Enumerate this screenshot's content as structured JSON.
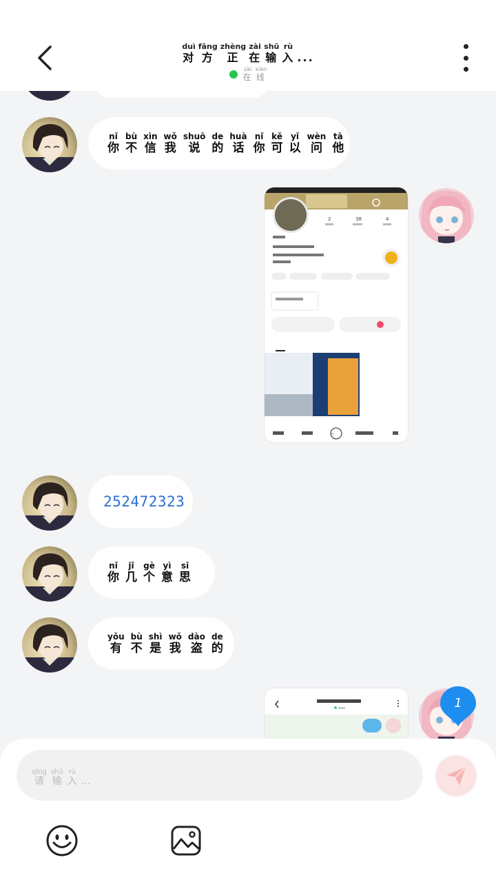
{
  "header": {
    "title_ruby": [
      {
        "py": "duì",
        "hz": "对"
      },
      {
        "py": "fāng",
        "hz": "方"
      },
      {
        "py": "zhèng",
        "hz": "正"
      },
      {
        "py": "zài",
        "hz": "在"
      },
      {
        "py": "shū",
        "hz": "输"
      },
      {
        "py": "rù",
        "hz": "入"
      },
      {
        "py": "",
        "hz": "..."
      }
    ],
    "status_ruby": [
      {
        "py": "zài",
        "hz": "在"
      },
      {
        "py": "xiàn",
        "hz": "线"
      }
    ],
    "status_color": "#26c64a"
  },
  "messages": [
    {
      "id": "m1",
      "from": "other",
      "type": "text",
      "ruby": [
        {
          "py": "nǐ",
          "hz": "你"
        },
        {
          "py": "bù",
          "hz": "不"
        },
        {
          "py": "xìn",
          "hz": "信"
        },
        {
          "py": "wǒ",
          "hz": "我"
        },
        {
          "py": "shuō",
          "hz": "说"
        },
        {
          "py": "de",
          "hz": "的"
        },
        {
          "py": "huà",
          "hz": "话"
        },
        {
          "py": "nǐ",
          "hz": "你"
        },
        {
          "py": "kě",
          "hz": "可"
        },
        {
          "py": "yǐ",
          "hz": "以"
        },
        {
          "py": "wèn",
          "hz": "问"
        },
        {
          "py": "tā",
          "hz": "他"
        }
      ]
    },
    {
      "id": "m2",
      "from": "me",
      "type": "image",
      "content": "screenshot-of-profile-page"
    },
    {
      "id": "m3",
      "from": "other",
      "type": "text",
      "text": "252472323"
    },
    {
      "id": "m4",
      "from": "other",
      "type": "text",
      "ruby": [
        {
          "py": "nǐ",
          "hz": "你"
        },
        {
          "py": "jǐ",
          "hz": "几"
        },
        {
          "py": "gè",
          "hz": "个"
        },
        {
          "py": "yì",
          "hz": "意"
        },
        {
          "py": "sī",
          "hz": "思"
        }
      ]
    },
    {
      "id": "m5",
      "from": "other",
      "type": "text",
      "ruby": [
        {
          "py": "yǒu",
          "hz": "有"
        },
        {
          "py": "bù",
          "hz": "不"
        },
        {
          "py": "shì",
          "hz": "是"
        },
        {
          "py": "wǒ",
          "hz": "我"
        },
        {
          "py": "dào",
          "hz": "盗"
        },
        {
          "py": "de",
          "hz": "的"
        }
      ]
    },
    {
      "id": "m6",
      "from": "me",
      "type": "image",
      "content": "screenshot-of-chat-page"
    }
  ],
  "unread_count": "1",
  "composer": {
    "placeholder_ruby": [
      {
        "py": "qǐng",
        "hz": "请"
      },
      {
        "py": "shū",
        "hz": "输"
      },
      {
        "py": "rù",
        "hz": "入"
      },
      {
        "py": "",
        "hz": "..."
      }
    ],
    "send_icon": "paper-plane-icon",
    "emoji_icon": "smiley-icon",
    "image_icon": "image-icon"
  },
  "colors": {
    "background": "#f3f4f6",
    "bubble": "#ffffff",
    "number_link": "#2b6fd6",
    "send_button": "#fce3e3"
  }
}
